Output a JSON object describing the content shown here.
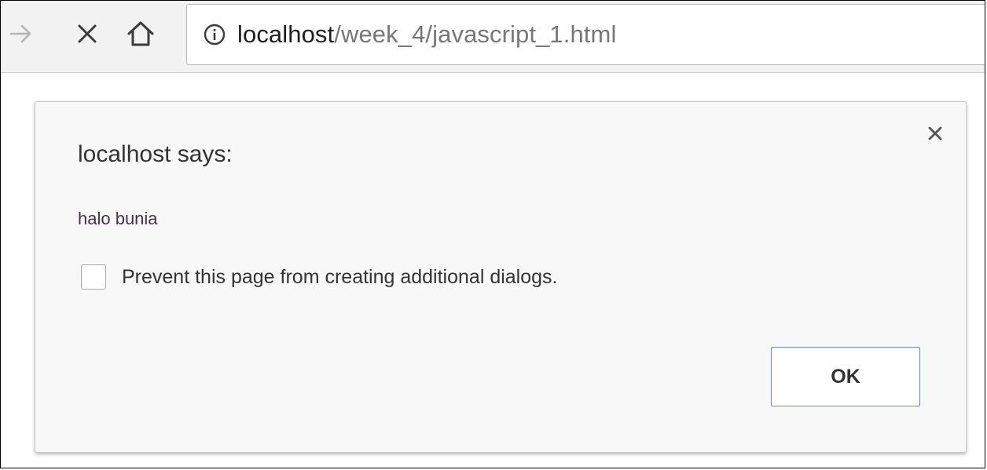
{
  "browser": {
    "url_host": "localhost",
    "url_path": "/week_4/javascript_1.html",
    "icons": {
      "forward": "forward-arrow-icon",
      "stop": "close-icon",
      "home": "home-icon",
      "site_info": "info-icon"
    }
  },
  "dialog": {
    "title": "localhost says:",
    "message": "halo bunia",
    "prevent_label": "Prevent this page from creating additional dialogs.",
    "prevent_checked": false,
    "ok_label": "OK",
    "close_icon": "close-icon",
    "accent_color": "#5a8fe0"
  }
}
